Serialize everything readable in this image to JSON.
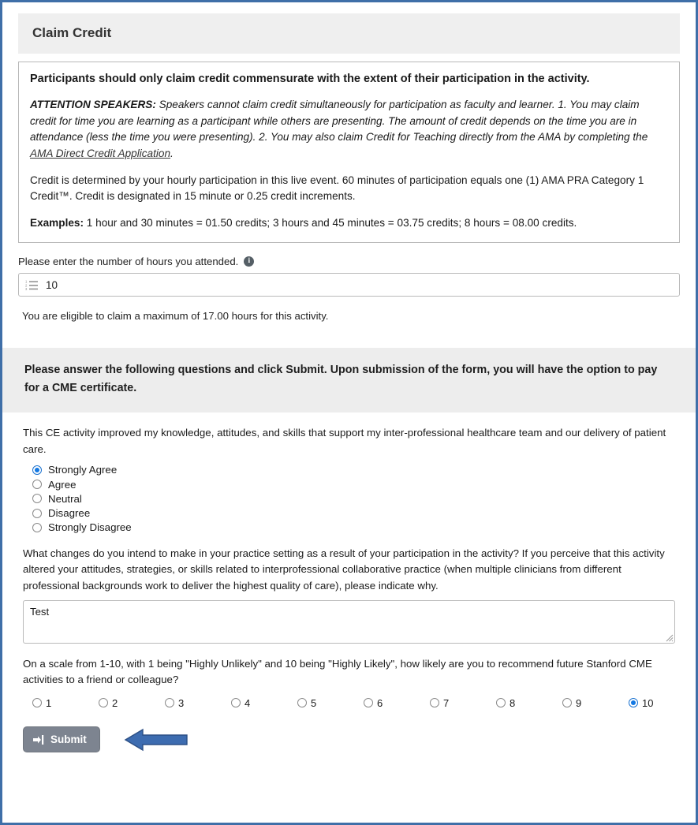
{
  "panel": {
    "header_title": "Claim Credit"
  },
  "info_box": {
    "lead": "Participants should only claim credit commensurate with the extent of their participation in the activity.",
    "attention_label": "ATTENTION SPEAKERS:",
    "attention_body_1": " Speakers cannot claim credit simultaneously for participation as faculty and learner.  1. You may claim credit for time you are learning as a participant while others are presenting. The amount of credit depends on the time you are in attendance (less the time you were presenting). 2. You may also claim Credit for Teaching directly from the AMA by completing the ",
    "attention_link": "AMA Direct Credit Application",
    "attention_body_2": ".",
    "credit_para": "Credit is determined by your hourly participation in this live event. 60 minutes of participation equals one (1) AMA PRA Category 1 Credit™. Credit is designated in 15 minute or 0.25 credit increments.",
    "examples_label": "Examples:",
    "examples_body": " 1 hour and 30 minutes = 01.50 credits; 3 hours and 45 minutes = 03.75 credits; 8 hours = 08.00 credits."
  },
  "hours_field": {
    "label": "Please enter the number of hours you attended.",
    "info_icon_char": "i",
    "value": "10",
    "placeholder": "",
    "icon": "ordered-list-icon",
    "eligibility_note": "You are eligible to claim a maximum of 17.00 hours for this activity."
  },
  "gray_panel": {
    "text": "Please answer the following questions and click Submit. Upon submission of the form, you will have the option to pay for a CME certificate."
  },
  "question_1": {
    "text": "This CE activity improved my knowledge, attitudes, and skills that support my inter-professional healthcare team and our delivery of patient care.",
    "options": [
      {
        "label": "Strongly Agree",
        "checked": true
      },
      {
        "label": "Agree",
        "checked": false
      },
      {
        "label": "Neutral",
        "checked": false
      },
      {
        "label": "Disagree",
        "checked": false
      },
      {
        "label": "Strongly Disagree",
        "checked": false
      }
    ]
  },
  "question_2": {
    "text": "What changes do you intend to make in your practice setting as a result of your participation in the activity? If you perceive that this activity altered your attitudes, strategies, or skills related to interprofessional collaborative practice (when multiple clinicians from different professional backgrounds work to deliver the highest quality of care), please indicate why.",
    "answer": "Test",
    "placeholder": ""
  },
  "question_3": {
    "text": "On a scale from 1-10, with 1 being \"Highly Unlikely\" and 10 being \"Highly Likely\", how likely are you to recommend future Stanford CME activities to a friend or colleague?",
    "options": [
      {
        "label": "1",
        "checked": false
      },
      {
        "label": "2",
        "checked": false
      },
      {
        "label": "3",
        "checked": false
      },
      {
        "label": "4",
        "checked": false
      },
      {
        "label": "5",
        "checked": false
      },
      {
        "label": "6",
        "checked": false
      },
      {
        "label": "7",
        "checked": false
      },
      {
        "label": "8",
        "checked": false
      },
      {
        "label": "9",
        "checked": false
      },
      {
        "label": "10",
        "checked": true
      }
    ]
  },
  "submit": {
    "label": "Submit",
    "icon": "sign-in-arrow-icon"
  },
  "annotation": {
    "arrow": "left-pointing-arrow"
  },
  "colors": {
    "page_border": "#3f6fa8",
    "header_bg": "#efefef",
    "gray_panel_bg": "#ededed",
    "radio_checked": "#1278e3",
    "submit_bg": "#7d8490",
    "annotation_arrow": "#3d6cb0"
  }
}
